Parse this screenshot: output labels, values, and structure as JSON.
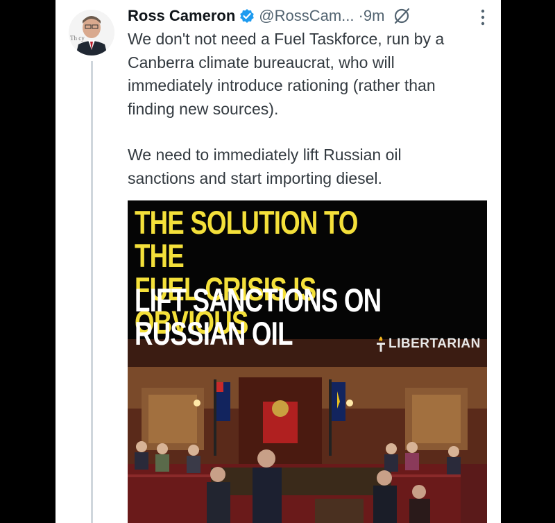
{
  "tweet": {
    "author_name": "Ross Cameron",
    "handle": "@RossCam...",
    "time": "·9m",
    "paragraphs": [
      "We don't not need a Fuel Taskforce, run by a\nCanberra climate bureaucrat, who will\nimmediately introduce rationing (rather than\nfinding new sources).",
      "We need to immediately lift Russian oil\nsanctions and start importing diesel."
    ],
    "avatar_badge_text": "Th   cy"
  },
  "media": {
    "headline_yellow": "The solution to the\nfuel crisis is obvious",
    "headline_white": "Lift sanctions on\nRussian oil",
    "brand": "LIBERTARIAN"
  },
  "icons": {
    "verified": "verified-badge-icon",
    "grok": "grok-icon",
    "more": "more-options-icon",
    "brand_logo": "libertarian-logo-icon"
  },
  "colors": {
    "verified_blue": "#1d9bf0",
    "headline_yellow": "#f4e03a",
    "text": "#333a40",
    "muted": "#536471"
  }
}
